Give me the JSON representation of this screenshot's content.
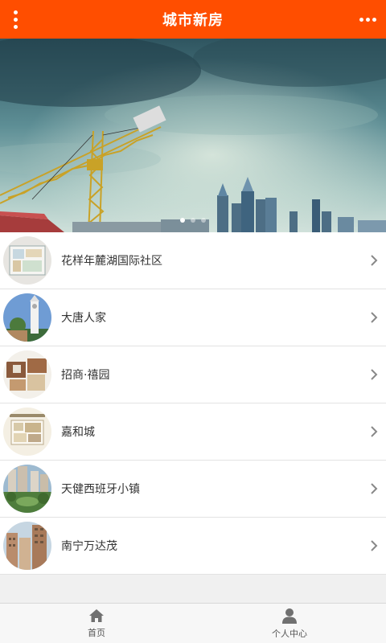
{
  "header": {
    "title": "城市新房",
    "menu_icon": "vertical-dots-icon",
    "more_icon": "horizontal-dots-icon",
    "background_color": "#ff4e00"
  },
  "banner": {
    "image_subject": "construction crane and city skyline",
    "carousel": {
      "slide_count": 3,
      "active_index": 0
    }
  },
  "listings": [
    {
      "name": "花样年麓湖国际社区",
      "thumb": "floor-plan"
    },
    {
      "name": "大唐人家",
      "thumb": "clock-tower"
    },
    {
      "name": "招商·禧园",
      "thumb": "floor-plan"
    },
    {
      "name": "嘉和城",
      "thumb": "floor-plan"
    },
    {
      "name": "天健西班牙小镇",
      "thumb": "garden-towers"
    },
    {
      "name": "南宁万达茂",
      "thumb": "towers"
    }
  ],
  "tabbar": {
    "tabs": [
      {
        "label": "首页",
        "icon": "home-icon"
      },
      {
        "label": "个人中心",
        "icon": "user-icon"
      }
    ]
  }
}
